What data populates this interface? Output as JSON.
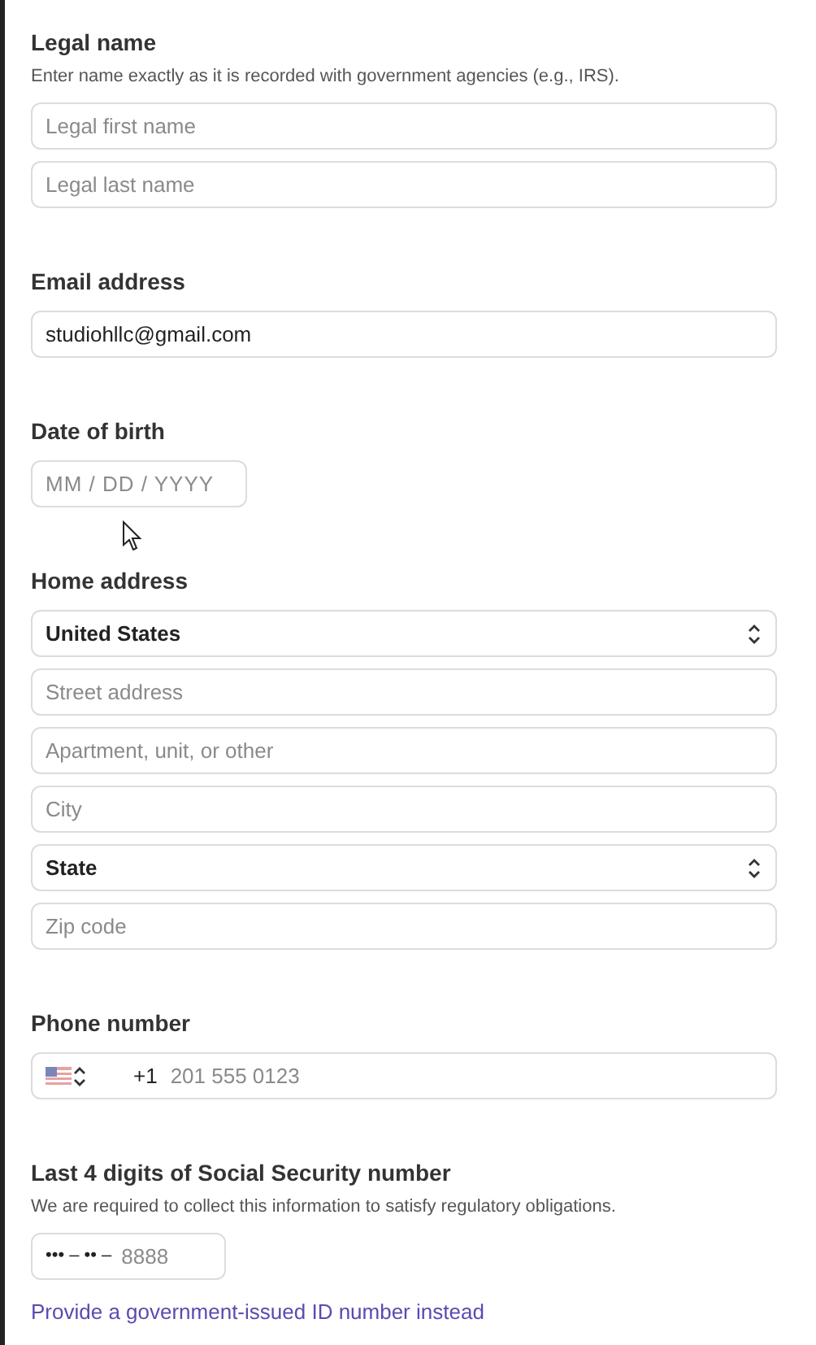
{
  "sections": [
    {
      "label": "Legal name",
      "helper": "Enter name exactly as it is recorded with government agencies (e.g., IRS).",
      "fields": [
        {
          "kind": "text",
          "placeholder": "Legal first name"
        },
        {
          "kind": "text",
          "placeholder": "Legal last name"
        }
      ]
    },
    {
      "label": "Email address",
      "fields": [
        {
          "kind": "text",
          "value": "studiohllc@gmail.com"
        }
      ]
    },
    {
      "label": "Date of birth",
      "fields": [
        {
          "kind": "date",
          "placeholder": "MM / DD / YYYY"
        }
      ]
    },
    {
      "label": "Home address",
      "fields": [
        {
          "kind": "select",
          "value": "United States"
        },
        {
          "kind": "text",
          "placeholder": "Street address"
        },
        {
          "kind": "text",
          "placeholder": "Apartment, unit, or other"
        },
        {
          "kind": "text",
          "placeholder": "City"
        },
        {
          "kind": "select",
          "value": "State"
        },
        {
          "kind": "text",
          "placeholder": "Zip code"
        }
      ]
    },
    {
      "label": "Phone number",
      "fields": [
        {
          "kind": "phone",
          "prefix": "+1",
          "placeholder": "201 555 0123"
        }
      ]
    },
    {
      "label": "Last 4 digits of Social Security number",
      "helper": "We are required to collect this information to satisfy regulatory obligations.",
      "fields": [
        {
          "kind": "ssn",
          "prefix": "••• – •• –",
          "placeholder": "8888"
        }
      ],
      "link": "Provide a government-issued ID number instead"
    }
  ]
}
